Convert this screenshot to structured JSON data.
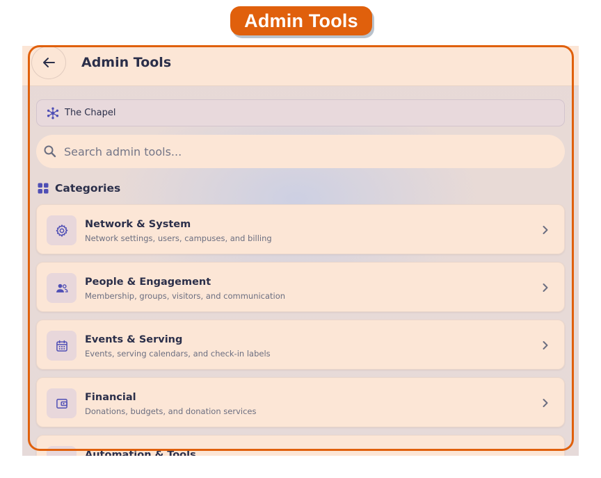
{
  "badge": {
    "label": "Admin Tools"
  },
  "appbar": {
    "title": "Admin Tools"
  },
  "org": {
    "name": "The Chapel",
    "icon": "network-icon"
  },
  "search": {
    "placeholder": "Search admin tools..."
  },
  "categories": {
    "header": "Categories",
    "items": [
      {
        "title": "Network & System",
        "description": "Network settings, users, campuses, and billing",
        "icon": "gear-icon"
      },
      {
        "title": "People & Engagement",
        "description": "Membership, groups, visitors, and communication",
        "icon": "people-icon"
      },
      {
        "title": "Events & Serving",
        "description": "Events, serving calendars, and check-in labels",
        "icon": "calendar-icon"
      },
      {
        "title": "Financial",
        "description": "Donations, budgets, and donation services",
        "icon": "wallet-icon"
      },
      {
        "title": "Automation & Tools",
        "description": "",
        "icon": "sparkle-icon"
      }
    ]
  },
  "colors": {
    "accent": "#e0600c",
    "icon": "#4f4fb5",
    "text": "#2b2f4a"
  }
}
